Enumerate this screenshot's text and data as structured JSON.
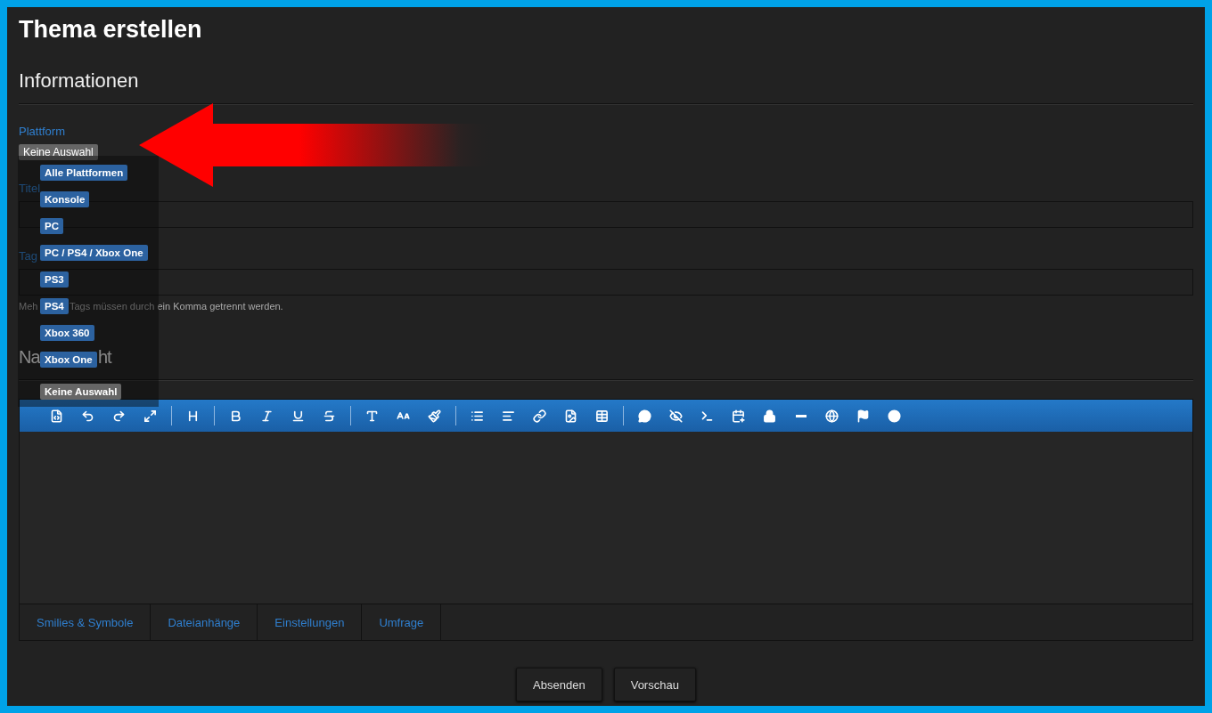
{
  "page": {
    "title": "Thema erstellen"
  },
  "informationen": {
    "heading": "Informationen",
    "platform": {
      "label": "Plattform",
      "value": "Keine Auswahl",
      "expanded": true,
      "options": [
        {
          "label": "Alle Plattformen",
          "selected": false
        },
        {
          "label": "Konsole",
          "selected": false
        },
        {
          "label": "PC",
          "selected": false
        },
        {
          "label": "PC / PS4 / Xbox One",
          "selected": false
        },
        {
          "label": "PS3",
          "selected": false
        },
        {
          "label": "PS4",
          "selected": false
        },
        {
          "label": "Xbox 360",
          "selected": false
        },
        {
          "label": "Xbox One",
          "selected": false
        },
        {
          "label": "Keine Auswahl",
          "selected": true
        }
      ]
    },
    "title_field": {
      "label": "Titel"
    },
    "tags_field": {
      "label": "Tag",
      "hint_parts": [
        "Meh",
        "Tags müssen durch ein Komma getrennt werden."
      ]
    }
  },
  "nachricht": {
    "heading_parts": [
      "Na",
      "ht"
    ],
    "tabs": [
      {
        "label": "Smilies & Symbole"
      },
      {
        "label": "Dateianhänge"
      },
      {
        "label": "Einstellungen"
      },
      {
        "label": "Umfrage"
      }
    ]
  },
  "buttons": [
    "Absenden",
    "Vorschau"
  ]
}
